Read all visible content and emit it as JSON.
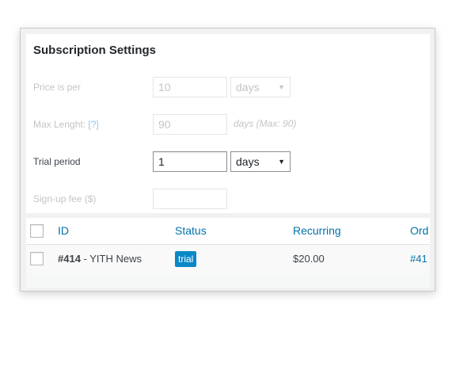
{
  "settings": {
    "title": "Subscription Settings",
    "price_is_per": {
      "label": "Price is per",
      "value": "10",
      "unit": "days"
    },
    "max_length": {
      "label": "Max Lenght:",
      "help": "[?]",
      "value": "90",
      "hint": "days (Max: 90)"
    },
    "trial_period": {
      "label": "Trial period",
      "value": "1",
      "unit": "days"
    },
    "signup_fee": {
      "label": "Sign-up fee ($)",
      "value": ""
    }
  },
  "table": {
    "columns": {
      "id": "ID",
      "status": "Status",
      "recurring": "Recurring",
      "order": "Ord"
    },
    "rows": [
      {
        "id": "#414",
        "name": " - YITH News",
        "status": "trial",
        "recurring": "$20.00",
        "order": "#41"
      }
    ]
  },
  "colors": {
    "accent": "#0073aa",
    "badge": "#0a87c6"
  }
}
